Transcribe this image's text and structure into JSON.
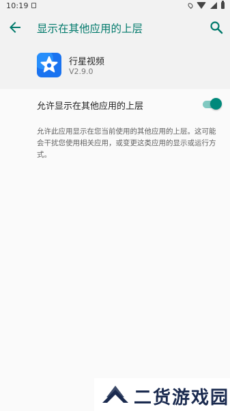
{
  "status_bar": {
    "time": "10:19"
  },
  "header": {
    "title": "显示在其他应用的上层"
  },
  "app": {
    "name": "行星视频",
    "version": "V2.9.0"
  },
  "setting": {
    "label": "允许显示在其他应用的上层",
    "enabled": true
  },
  "description": "允许此应用显示在您当前使用的其他应用的上层。这可能会干扰您使用相关应用，或变更这类应用的显示或运行方式。",
  "watermark": {
    "text": "二货游戏园"
  },
  "colors": {
    "accent": "#00796b",
    "toggle_on": "#00897b",
    "app_icon": "#1a73f0"
  }
}
